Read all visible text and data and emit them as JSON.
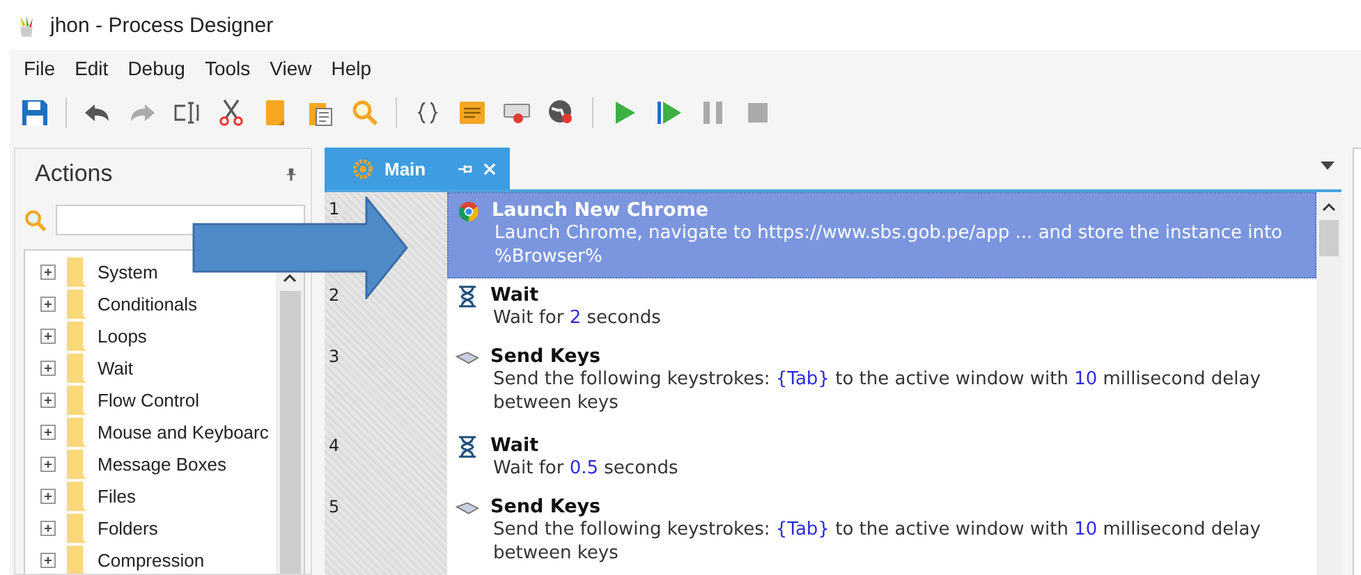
{
  "window": {
    "title": "jhon - Process Designer"
  },
  "menu": [
    "File",
    "Edit",
    "Debug",
    "Tools",
    "View",
    "Help"
  ],
  "toolbar": [
    {
      "kind": "save"
    },
    {
      "kind": "sep"
    },
    {
      "kind": "undo"
    },
    {
      "kind": "redo"
    },
    {
      "kind": "rename"
    },
    {
      "kind": "cut"
    },
    {
      "kind": "copy"
    },
    {
      "kind": "paste"
    },
    {
      "kind": "find"
    },
    {
      "kind": "sep"
    },
    {
      "kind": "braces"
    },
    {
      "kind": "note"
    },
    {
      "kind": "record"
    },
    {
      "kind": "web"
    },
    {
      "kind": "sep"
    },
    {
      "kind": "run"
    },
    {
      "kind": "step"
    },
    {
      "kind": "pause"
    },
    {
      "kind": "stop"
    }
  ],
  "actions_panel": {
    "title": "Actions",
    "items": [
      {
        "label": "System",
        "expanded": false
      },
      {
        "label": "Conditionals",
        "expanded": false
      },
      {
        "label": "Loops",
        "expanded": false
      },
      {
        "label": "Wait",
        "expanded": false
      },
      {
        "label": "Flow Control",
        "expanded": false
      },
      {
        "label": "Mouse and Keyboarc",
        "expanded": false
      },
      {
        "label": "Message Boxes",
        "expanded": false
      },
      {
        "label": "Files",
        "expanded": false
      },
      {
        "label": "Folders",
        "expanded": false
      },
      {
        "label": "Compression",
        "expanded": false
      }
    ]
  },
  "tabs": [
    {
      "label": "Main",
      "selected": true
    }
  ],
  "steps": [
    {
      "number": "1",
      "kind": "chrome",
      "title": "Launch New Chrome",
      "selected": true,
      "description": [
        {
          "text": "Launch Chrome, navigate to https://www.sbs.gob.pe/app ... and store the instance into %Browser%",
          "highlight": false
        }
      ]
    },
    {
      "number": "2",
      "kind": "wait",
      "title": "Wait",
      "selected": false,
      "description": [
        {
          "text": "Wait for ",
          "highlight": false
        },
        {
          "text": "2",
          "highlight": true
        },
        {
          "text": " seconds",
          "highlight": false
        }
      ]
    },
    {
      "number": "3",
      "kind": "keys",
      "title": "Send Keys",
      "selected": false,
      "description": [
        {
          "text": "Send the following keystrokes: ",
          "highlight": false
        },
        {
          "text": "{Tab}",
          "highlight": true
        },
        {
          "text": " to the active window with ",
          "highlight": false
        },
        {
          "text": "10",
          "highlight": true
        },
        {
          "text": " millisecond delay between keys",
          "highlight": false
        }
      ]
    },
    {
      "number": "4",
      "kind": "wait",
      "title": "Wait",
      "selected": false,
      "description": [
        {
          "text": "Wait for ",
          "highlight": false
        },
        {
          "text": "0.5",
          "highlight": true
        },
        {
          "text": " seconds",
          "highlight": false
        }
      ]
    },
    {
      "number": "5",
      "kind": "keys",
      "title": "Send Keys",
      "selected": false,
      "description": [
        {
          "text": "Send the following keystrokes: ",
          "highlight": false
        },
        {
          "text": "{Tab}",
          "highlight": true
        },
        {
          "text": " to the active window with ",
          "highlight": false
        },
        {
          "text": "10",
          "highlight": true
        },
        {
          "text": " millisecond delay between keys",
          "highlight": false
        }
      ]
    }
  ]
}
